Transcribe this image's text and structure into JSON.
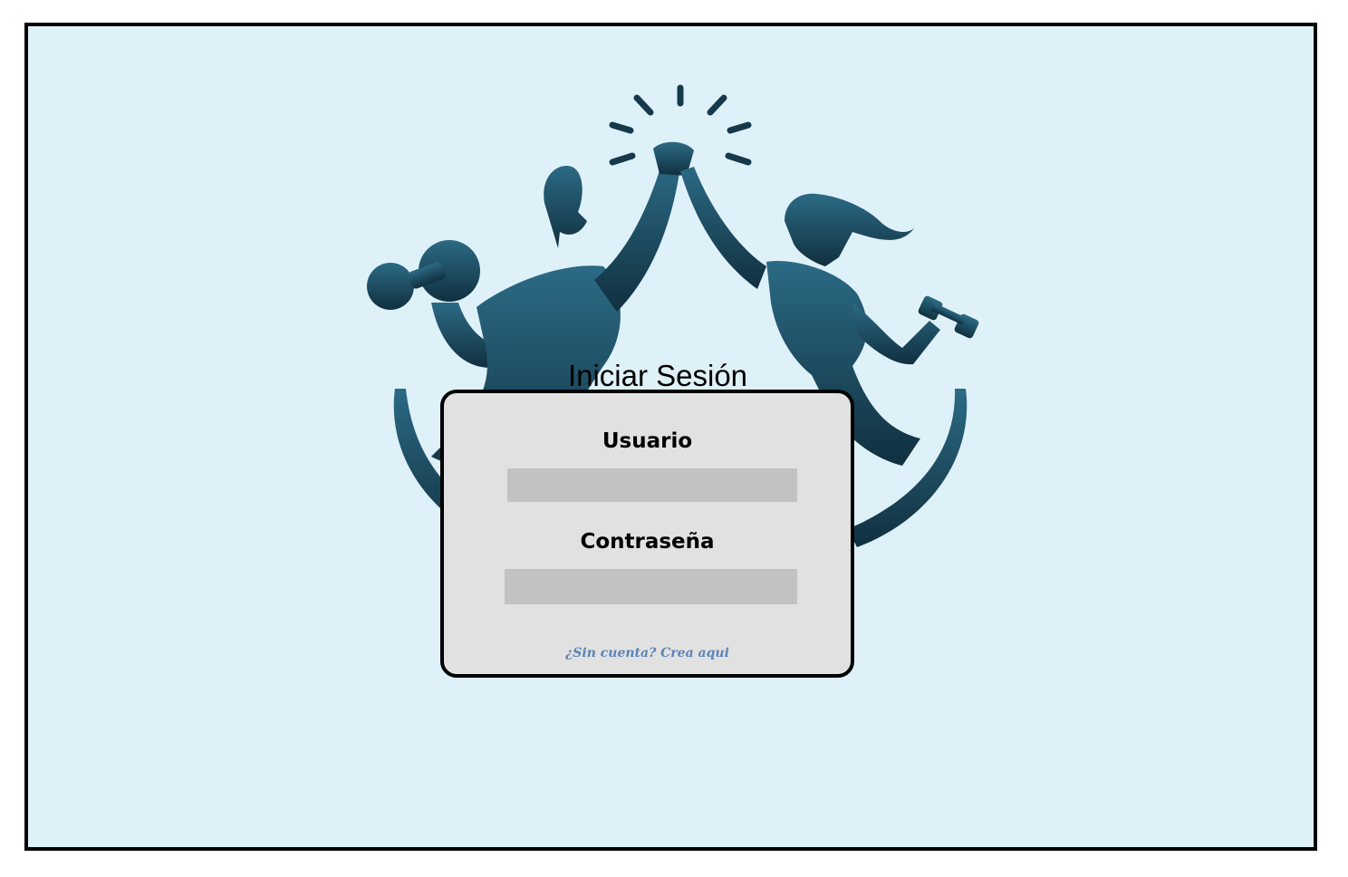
{
  "app": {
    "title": "Iniciar Sesión"
  },
  "logo": {
    "icon": "fitness-couple-high-five-logo",
    "color": "#163a4c"
  },
  "login_form": {
    "username_label": "Usuario",
    "username_value": "",
    "password_label": "Contraseña",
    "password_value": "",
    "signup_link": "¿Sin cuenta? Crea aqui"
  },
  "colors": {
    "background": "#dff1f8",
    "card": "#e1e1e1",
    "input": "#c2c2c2",
    "link": "#5b84b8",
    "logo": "#163a4c"
  }
}
